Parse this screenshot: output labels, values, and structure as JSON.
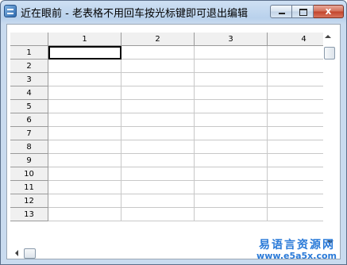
{
  "window": {
    "title": "近在眼前 - 老表格不用回车按光标键即可退出编辑",
    "close_glyph": "x"
  },
  "grid": {
    "columns": [
      "1",
      "2",
      "3",
      "4"
    ],
    "rows": [
      "1",
      "2",
      "3",
      "4",
      "5",
      "6",
      "7",
      "8",
      "9",
      "10",
      "11",
      "12",
      "13"
    ],
    "selected_cell": {
      "row": 1,
      "col": 1
    }
  },
  "watermark": {
    "line1": "易语言资源网",
    "line2": "www.e5a5x.com"
  }
}
